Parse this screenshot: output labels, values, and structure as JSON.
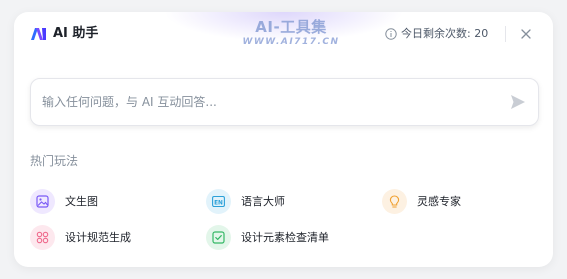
{
  "header": {
    "title": "AI 助手",
    "quota_label": "今日剩余次数: 20",
    "brand_color": "#4a3aff"
  },
  "watermark": {
    "line1": "AI-工具集",
    "line2": "WWW.AI717.CN"
  },
  "search": {
    "placeholder": "输入任何问题，与 AI 互动回答..."
  },
  "section": {
    "title": "热门玩法"
  },
  "features": [
    {
      "label": "文生图",
      "icon": "image-icon",
      "bg": "#efe8ff",
      "color": "#7a5af5"
    },
    {
      "label": "语言大师",
      "icon": "en-icon",
      "bg": "#e2f3fb",
      "color": "#2ba0d8"
    },
    {
      "label": "灵感专家",
      "icon": "lightbulb-icon",
      "bg": "#fdf1e2",
      "color": "#f0a030"
    },
    {
      "label": "设计规范生成",
      "icon": "grid-icon",
      "bg": "#fde8ee",
      "color": "#ef6a8d"
    },
    {
      "label": "设计元素检查清单",
      "icon": "checklist-icon",
      "bg": "#e3f6ea",
      "color": "#34b866"
    }
  ]
}
